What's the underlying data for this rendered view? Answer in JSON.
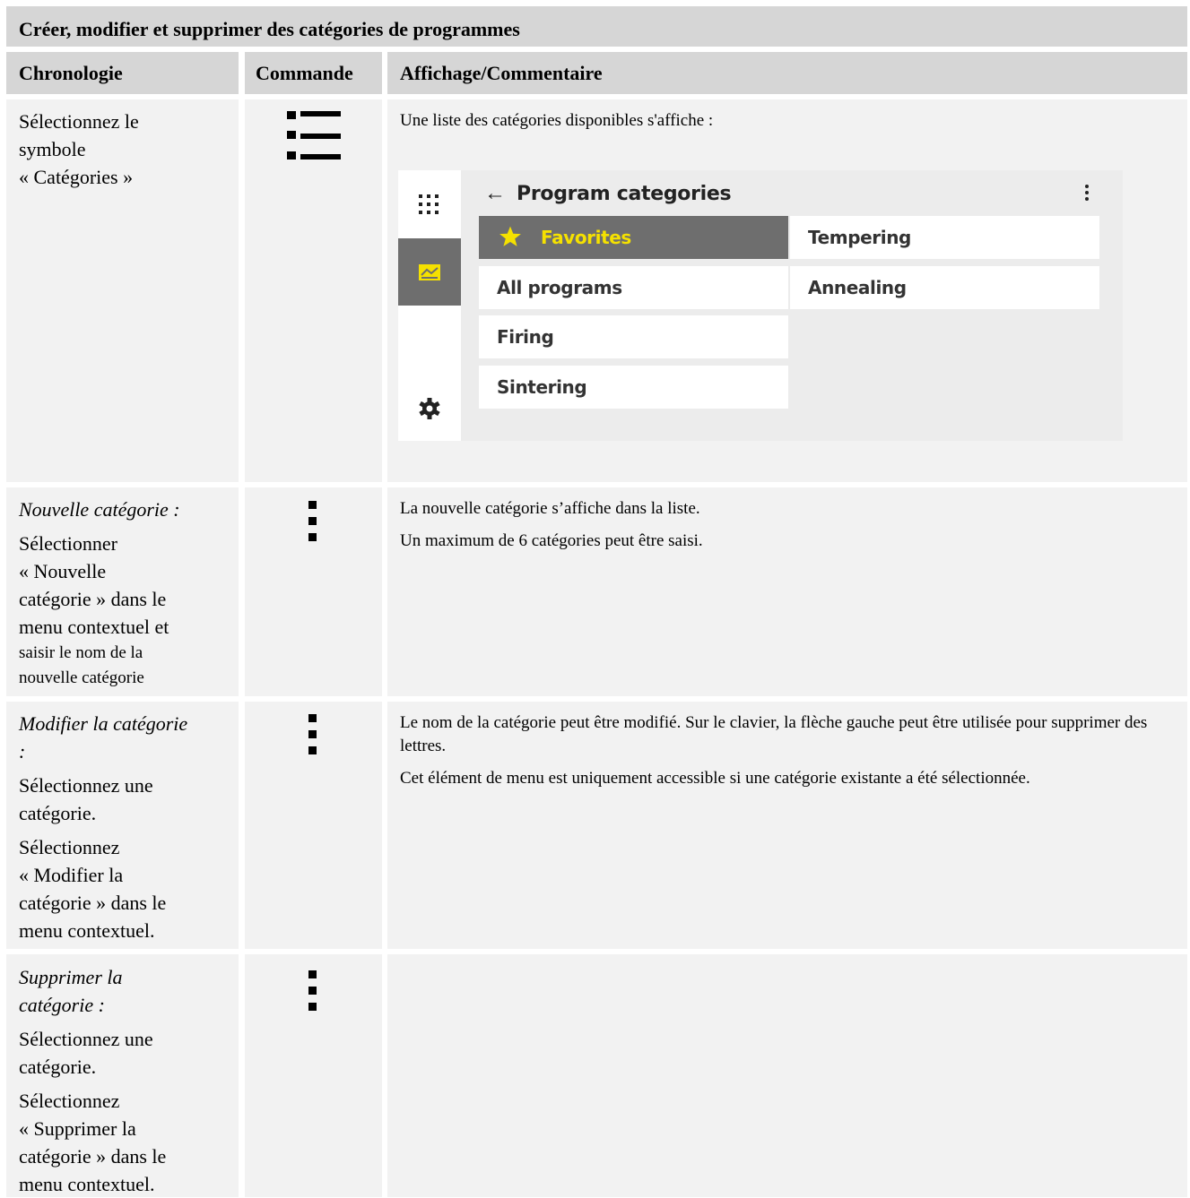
{
  "title": "Créer, modifier et supprimer des catégories de programmes",
  "headers": {
    "chronologie": "Chronologie",
    "commande": "Commande",
    "affichage": "Affichage/Commentaire"
  },
  "rows": [
    {
      "chron_lines": [
        "Sélectionnez le",
        "symbole",
        "« Catégories »"
      ],
      "command_icon": "list-icon",
      "comment": [
        "Une liste des catégories disponibles s'affiche :"
      ]
    },
    {
      "heading": "Nouvelle catégorie :",
      "chron_lines": [
        "Sélectionner",
        "« Nouvelle",
        "catégorie » dans le",
        "menu contextuel et"
      ],
      "chron_small": [
        "saisir le nom de la",
        "nouvelle catégorie"
      ],
      "command_icon": "kebab-menu-icon",
      "comment": [
        "La nouvelle catégorie s’affiche dans la liste.",
        "Un maximum de 6 catégories peut être saisi."
      ]
    },
    {
      "heading_lines": [
        "Modifier la catégorie",
        ":"
      ],
      "para1": [
        "Sélectionnez une",
        "catégorie."
      ],
      "para2": [
        "Sélectionnez",
        "« Modifier la",
        "catégorie » dans le",
        "menu contextuel."
      ],
      "command_icon": "kebab-menu-icon",
      "comment": [
        "Le nom de la catégorie peut être modifié. Sur le clavier, la flèche gauche peut être utilisée pour supprimer des lettres.",
        "Cet élément de menu est uniquement accessible si une catégorie existante a été sélectionnée."
      ]
    },
    {
      "heading_lines": [
        "Supprimer la",
        "catégorie :"
      ],
      "para1": [
        "Sélectionnez une",
        "catégorie."
      ],
      "para2": [
        "Sélectionnez",
        "« Supprimer la",
        "catégorie » dans le",
        "menu contextuel."
      ],
      "command_icon": "kebab-menu-icon",
      "comment": []
    }
  ],
  "screen": {
    "title": "Program categories",
    "back_icon": "arrow-left-icon",
    "rail_icons": [
      "apps-grid-icon",
      "chart-icon",
      "gear-icon"
    ],
    "accent_color": "#f5e100",
    "selected_bg": "#6e6e6e",
    "categories_col1": [
      "Favorites",
      "All programs",
      "Firing",
      "Sintering"
    ],
    "categories_col2": [
      "Tempering",
      "Annealing"
    ],
    "selected": "Favorites"
  }
}
